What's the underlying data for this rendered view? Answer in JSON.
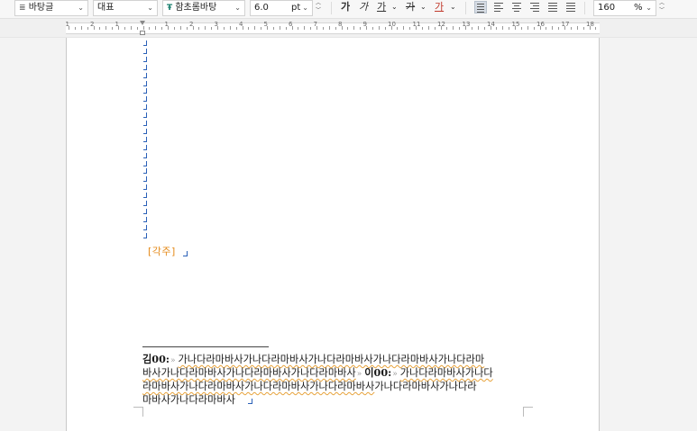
{
  "toolbar": {
    "style_value": "바탕글",
    "lang_value": "대표",
    "font_value": "함초롬바탕",
    "font_icon": "TrueType-font-icon",
    "size_value": "6.0",
    "size_unit": "pt",
    "bold": "가",
    "italic": "가",
    "underline": "가",
    "strike": "가",
    "color": "가",
    "line_spacing_value": "160",
    "line_spacing_unit": "%"
  },
  "ruler": {
    "numbers": [
      "1",
      "2",
      "1",
      "1",
      "2",
      "3",
      "4",
      "5",
      "6",
      "7",
      "8",
      "9",
      "10",
      "11",
      "12",
      "13",
      "14",
      "15",
      "16",
      "17",
      "18"
    ]
  },
  "document": {
    "footnote_label": "[각주]",
    "footnote_lines": [
      {
        "parts": [
          {
            "b": "김00:"
          },
          {
            "tab": "»"
          },
          {
            "u": "가나다라마바사가나다라마바사가나다라마바사가나다라마바사가나다라마"
          }
        ]
      },
      {
        "parts": [
          {
            "u": "바사가나다라마바사가나다라마바사가나다라마바사"
          },
          {
            "tab": "»"
          },
          {
            "b": "이00:"
          },
          {
            "tab": "»"
          },
          {
            "u": "가나다라마바사가나다"
          }
        ]
      },
      {
        "parts": [
          {
            "u": "라마바사가나다라마바사가나다라마바사가나다라마바사"
          },
          {
            "t": "가나다라마바사가나다라"
          }
        ]
      },
      {
        "parts": [
          {
            "t": "마바사가나다라마바사"
          }
        ]
      }
    ]
  },
  "colors": {
    "accent_blue": "#2b61b8",
    "footnote_orange": "#e48a1a"
  }
}
